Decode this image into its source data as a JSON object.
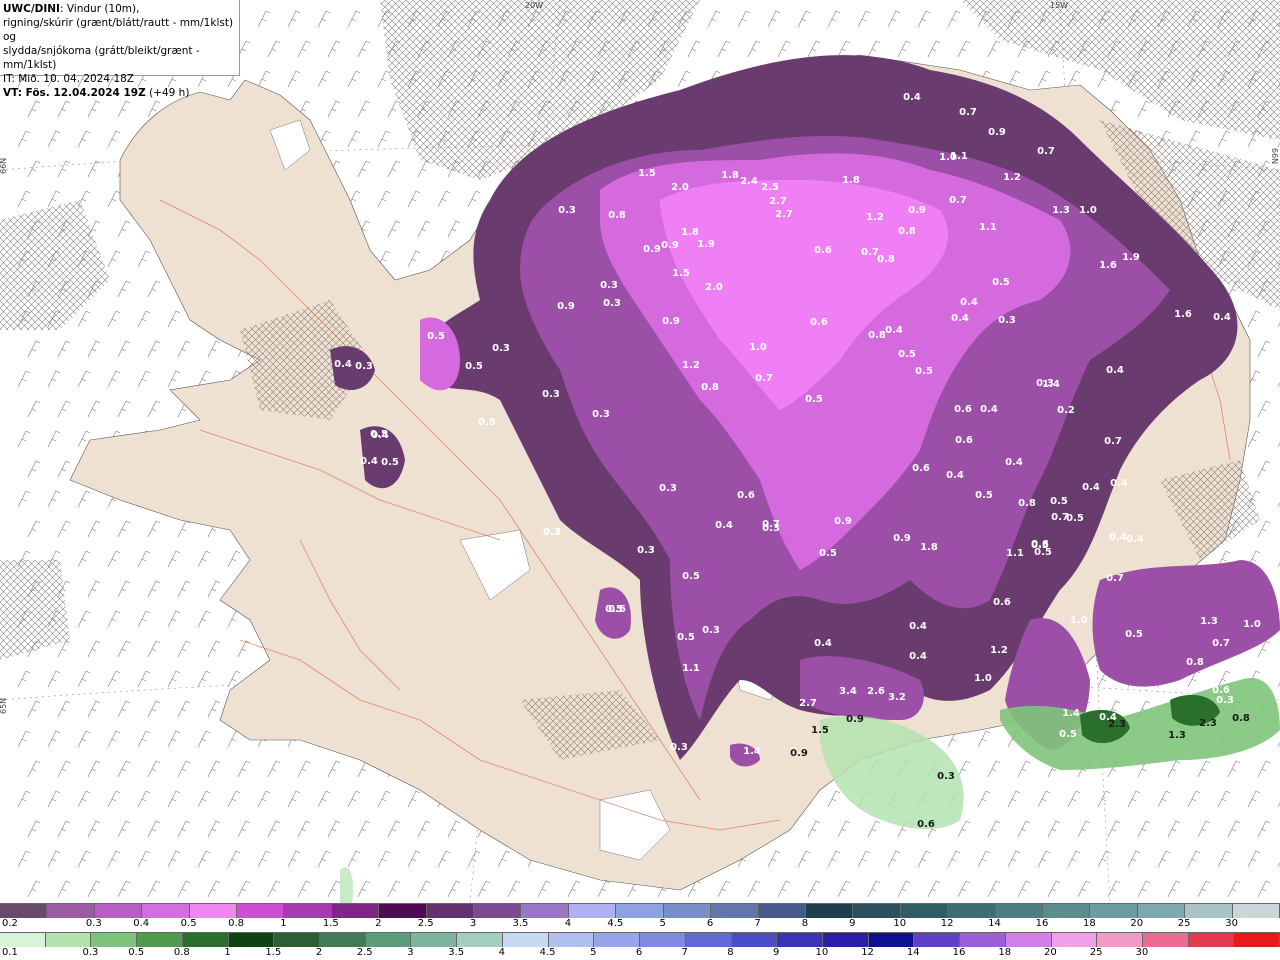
{
  "info": {
    "model": "UWC/DINI",
    "line1_rest": ": Vindur (10m),",
    "line2": "rigning/skúrir (grænt/blátt/rautt - mm/1klst) og",
    "line3": "slydda/snjókoma (grátt/bleikt/grænt - mm/1klst)",
    "line4": "IT: Mið. 10. 04. 2024 18Z",
    "line5_bold": "VT: Fös. 12.04.2024 19Z",
    "line5_rest": " (+49 h)"
  },
  "coords": {
    "lon_20w": "20W",
    "lon_15w": "15W",
    "lat_66n_left": "66N",
    "lat_66n_right": "66N",
    "lat_65n_left": "65N"
  },
  "colors": {
    "sea": "#ffffff",
    "land": "#efe1d2",
    "roads": "#e0704a",
    "precip_dark": "#6a3b6e",
    "precip_mid": "#9b4fa6",
    "precip_light": "#d56adf",
    "precip_bright": "#f07ef4",
    "rain_green": "#66b86b",
    "rain_dark_green": "#1f6b2a"
  },
  "value_labels": [
    {
      "t": "1.5"
    },
    {
      "t": "2.0"
    },
    {
      "t": "1.8"
    },
    {
      "t": "2.4"
    },
    {
      "t": "2.5"
    },
    {
      "t": "2.7"
    },
    {
      "t": "2.7"
    },
    {
      "t": "1.8"
    },
    {
      "t": "0.4"
    },
    {
      "t": "0.7"
    },
    {
      "t": "0.9"
    },
    {
      "t": "1.0"
    },
    {
      "t": "1.1"
    },
    {
      "t": "1.2"
    },
    {
      "t": "0.7"
    },
    {
      "t": "1.3"
    },
    {
      "t": "1.0"
    },
    {
      "t": "0.3"
    },
    {
      "t": "0.8"
    },
    {
      "t": "0.9"
    },
    {
      "t": "0.9"
    },
    {
      "t": "1.8"
    },
    {
      "t": "1.9"
    },
    {
      "t": "1.5"
    },
    {
      "t": "2.0"
    },
    {
      "t": "1.2"
    },
    {
      "t": "0.9"
    },
    {
      "t": "0.8"
    },
    {
      "t": "1.1"
    },
    {
      "t": "0.7"
    },
    {
      "t": "0.6"
    },
    {
      "t": "0.7"
    },
    {
      "t": "0.8"
    },
    {
      "t": "1.6"
    },
    {
      "t": "1.9"
    },
    {
      "t": "0.5"
    },
    {
      "t": "0.4"
    },
    {
      "t": "0.3"
    },
    {
      "t": "1.6"
    },
    {
      "t": "0.4"
    },
    {
      "t": "0.3"
    },
    {
      "t": "0.3"
    },
    {
      "t": "0.5"
    },
    {
      "t": "0.9"
    },
    {
      "t": "0.9"
    },
    {
      "t": "1.0"
    },
    {
      "t": "0.7"
    },
    {
      "t": "0.6"
    },
    {
      "t": "0.8"
    },
    {
      "t": "0.4"
    },
    {
      "t": "0.4"
    },
    {
      "t": "0.3"
    },
    {
      "t": "0.5"
    },
    {
      "t": "0.5"
    },
    {
      "t": "0.5"
    },
    {
      "t": "1.2"
    },
    {
      "t": "0.8"
    },
    {
      "t": "0.3"
    },
    {
      "t": "0.3"
    },
    {
      "t": "0.2"
    },
    {
      "t": "0.4"
    },
    {
      "t": "0.5"
    },
    {
      "t": "0.3"
    },
    {
      "t": "0.5"
    },
    {
      "t": "0.4"
    },
    {
      "t": "0.6"
    },
    {
      "t": "0.4"
    },
    {
      "t": "0.6"
    },
    {
      "t": "0.4"
    },
    {
      "t": "0.7"
    },
    {
      "t": "0.4"
    },
    {
      "t": "0.5"
    },
    {
      "t": "0.6"
    },
    {
      "t": "0.8"
    },
    {
      "t": "0.5"
    },
    {
      "t": "0.5"
    },
    {
      "t": "0.4"
    },
    {
      "t": "0.4"
    },
    {
      "t": "0.3"
    },
    {
      "t": "0.6"
    },
    {
      "t": "0.4"
    },
    {
      "t": "0.5"
    },
    {
      "t": "0.7"
    },
    {
      "t": "0.3"
    },
    {
      "t": "0.3"
    },
    {
      "t": "0.7"
    },
    {
      "t": "0.9"
    },
    {
      "t": "1.8"
    },
    {
      "t": "0.9"
    },
    {
      "t": "1.1"
    },
    {
      "t": "0.5"
    },
    {
      "t": "0.6"
    },
    {
      "t": "0.5"
    },
    {
      "t": "0.7"
    },
    {
      "t": "1.0"
    },
    {
      "t": "0.5"
    },
    {
      "t": "1.3"
    },
    {
      "t": "1.0"
    },
    {
      "t": "0.4"
    },
    {
      "t": "0.4"
    },
    {
      "t": "1.2"
    },
    {
      "t": "1.0"
    },
    {
      "t": "0.6"
    },
    {
      "t": "0.7"
    },
    {
      "t": "0.8"
    },
    {
      "t": "1.4"
    },
    {
      "t": "1.1"
    },
    {
      "t": "0.4"
    },
    {
      "t": "3.4"
    },
    {
      "t": "2.6"
    },
    {
      "t": "3.2"
    },
    {
      "t": "2.7"
    },
    {
      "t": "0.9"
    },
    {
      "t": "1.4"
    },
    {
      "t": "0.3"
    },
    {
      "t": "0.5"
    },
    {
      "t": "0.6"
    },
    {
      "t": "0.4"
    },
    {
      "t": "0.4"
    },
    {
      "t": "0.3"
    },
    {
      "t": "0.5"
    },
    {
      "t": "0.5"
    },
    {
      "t": "0.4"
    },
    {
      "t": "0.4"
    },
    {
      "t": "0.3"
    },
    {
      "t": "0.7"
    },
    {
      "t": "0.5"
    },
    {
      "t": "0.3"
    },
    {
      "t": "0.5"
    },
    {
      "t": "0.4"
    },
    {
      "t": "0.4"
    },
    {
      "t": "0.3"
    },
    {
      "t": "0.5"
    },
    {
      "t": "0.6"
    },
    {
      "t": "1.4"
    },
    {
      "t": "1.2"
    },
    {
      "t": "0.2"
    },
    {
      "t": "0.3"
    }
  ],
  "dark_value_labels": [
    {
      "t": "0.9"
    },
    {
      "t": "1.5"
    },
    {
      "t": "0.9"
    },
    {
      "t": "0.3"
    },
    {
      "t": "0.6"
    },
    {
      "t": "2.3"
    },
    {
      "t": "1.3"
    },
    {
      "t": "2.3"
    },
    {
      "t": "0.8"
    }
  ],
  "legend": {
    "snow": {
      "colors": [
        "#6a4a6a",
        "#9b5aa3",
        "#b65ec2",
        "#d16fdc",
        "#ef87f1",
        "#d04cd5",
        "#a73aad",
        "#7e2684",
        "#4e0a52",
        "#64306e",
        "#7a4a92",
        "#9a76c5",
        "#aeb0f0",
        "#8fa2dd",
        "#7a8ec7",
        "#6276ac",
        "#46598b",
        "#213e4f",
        "#2b4f5c",
        "#2f5d66",
        "#3e6e73",
        "#4f7e82",
        "#5d8c8e",
        "#6d9b9e",
        "#7fa9ac",
        "#a8c4c5",
        "#c9d7d8"
      ],
      "labels": [
        "0.2",
        "0.3",
        "0.4",
        "0.5",
        "0.8",
        "1",
        "1.5",
        "2",
        "2.5",
        "3",
        "3.5",
        "4",
        "4.5",
        "5",
        "6",
        "7",
        "8",
        "9",
        "10",
        "12",
        "14",
        "16",
        "18",
        "20",
        "25",
        "30"
      ]
    },
    "rain": {
      "colors": [
        "#d9f3d8",
        "#b4e3b0",
        "#7fc47a",
        "#4f9c4e",
        "#2a6f2c",
        "#0e4412",
        "#2d5f37",
        "#3f7c55",
        "#5e9b7a",
        "#7fb39d",
        "#a3cfc3",
        "#c7d8f3",
        "#b3c0ef",
        "#9aa4ea",
        "#8088e0",
        "#6468d3",
        "#4c4cc6",
        "#3a33b6",
        "#2b1fa7",
        "#0f0f90",
        "#6040c2",
        "#9a5fd8",
        "#d080e6",
        "#f0a0e8",
        "#f29bc6",
        "#ec6b92",
        "#e43a52",
        "#e61a1a"
      ],
      "labels": [
        "0.1",
        "0.3",
        "0.5",
        "0.8",
        "1",
        "1.5",
        "2",
        "2.5",
        "3",
        "3.5",
        "4",
        "4.5",
        "5",
        "6",
        "7",
        "8",
        "9",
        "10",
        "12",
        "14",
        "16",
        "18",
        "20",
        "25",
        "30"
      ]
    }
  }
}
